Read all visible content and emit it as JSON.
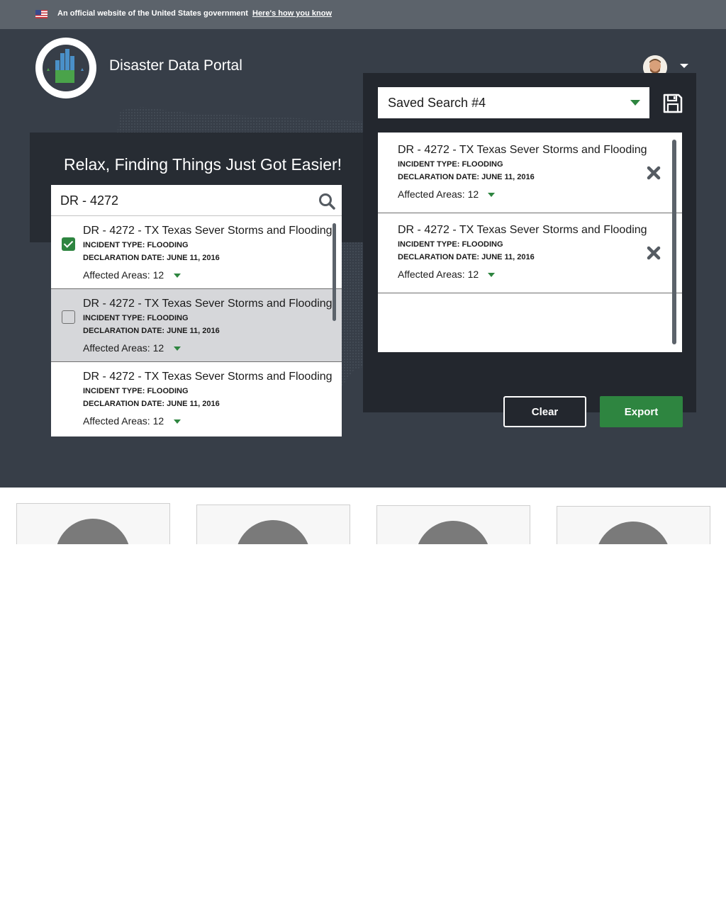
{
  "gov_banner": {
    "text": "An official website of the United States government",
    "link": "Here's how you know"
  },
  "header": {
    "logo_alt": "U.S. Department of Housing and Urban Development",
    "title": "Disaster Data Portal"
  },
  "search": {
    "heading": "Relax, Finding Things Just Got Easier!",
    "query": "DR - 4272",
    "results": [
      {
        "title": "DR - 4272 - TX Texas Sever Storms and Flooding",
        "incident_type": "INCIDENT TYPE: FLOODING",
        "declaration_date": "DECLARATION DATE: JUNE 11, 2016",
        "affected_areas": "Affected Areas: 12",
        "checked": true
      },
      {
        "title": "DR - 4272 - TX Texas Sever Storms and Flooding",
        "incident_type": "INCIDENT TYPE: FLOODING",
        "declaration_date": "DECLARATION DATE: JUNE 11, 2016",
        "affected_areas": "Affected Areas: 12",
        "checked": false
      },
      {
        "title": "DR - 4272 - TX Texas Sever Storms and Flooding",
        "incident_type": "INCIDENT TYPE: FLOODING",
        "declaration_date": "DECLARATION DATE: JUNE 11, 2016",
        "affected_areas": "Affected Areas: 12",
        "checked": false
      }
    ]
  },
  "saved": {
    "selected": "Saved Search #4",
    "items": [
      {
        "title": "DR - 4272 - TX Texas Sever Storms and Flooding",
        "incident_type": "INCIDENT TYPE: FLOODING",
        "declaration_date": "DECLARATION DATE: JUNE 11, 2016",
        "affected_areas": "Affected Areas: 12"
      },
      {
        "title": "DR - 4272 - TX Texas Sever Storms and Flooding",
        "incident_type": "INCIDENT TYPE: FLOODING",
        "declaration_date": "DECLARATION DATE: JUNE 11, 2016",
        "affected_areas": "Affected Areas: 12"
      }
    ],
    "clear_label": "Clear",
    "export_label": "Export"
  },
  "colors": {
    "banner": "#5c636b",
    "hero": "#373e48",
    "panel": "#23272e",
    "accent_green": "#2e8540",
    "selected_row": "#d6d7da",
    "card_avatar": "#7a7a7a"
  },
  "icons": [
    "us-flag-icon",
    "hud-seal-logo",
    "user-avatar",
    "chevron-down-icon",
    "search-icon",
    "checkbox-checked",
    "checkbox-unchecked",
    "save-icon",
    "close-icon"
  ]
}
